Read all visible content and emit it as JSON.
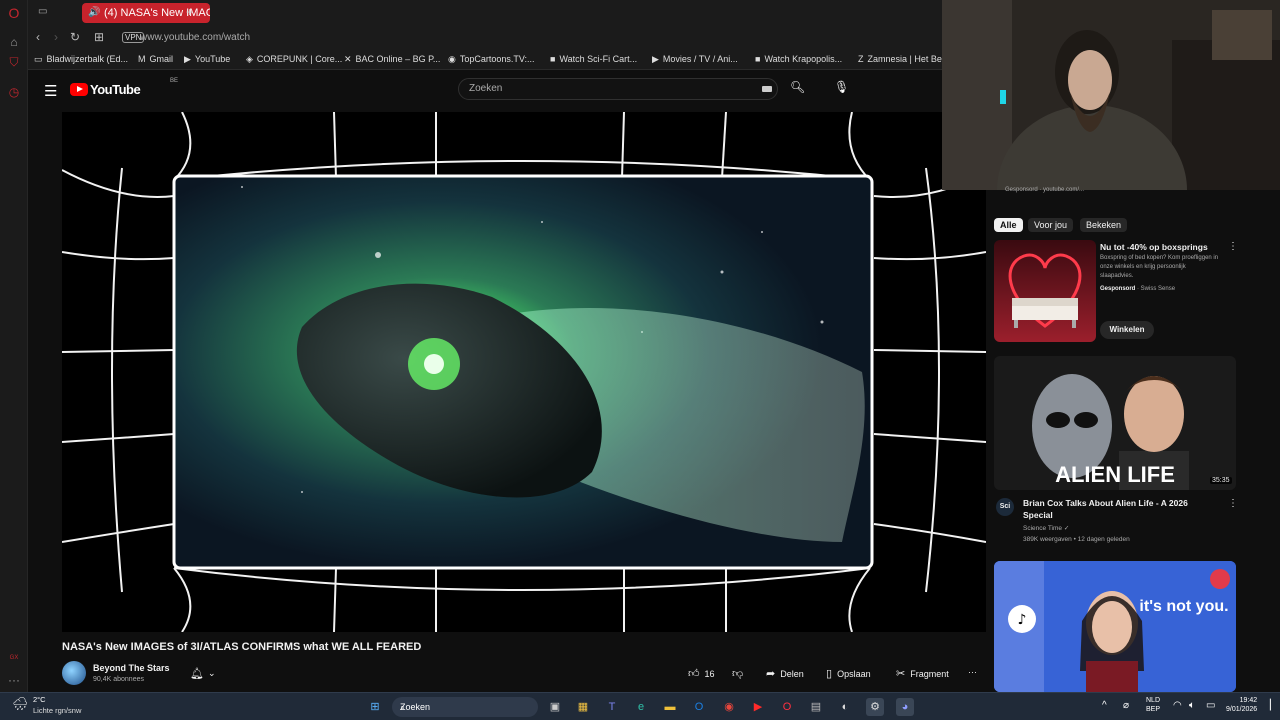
{
  "browser": {
    "active_tab_title": "(4) NASA's New IMAGE",
    "new_tab_glyph": "+",
    "url": "www.youtube.com/watch",
    "vpn_label": "VPN",
    "bookmarks": [
      {
        "icon": "▭",
        "label": "Bladwijzerbalk (Ed..."
      },
      {
        "icon": "M",
        "label": "Gmail"
      },
      {
        "icon": "▶",
        "label": "YouTube"
      },
      {
        "icon": "◈",
        "label": "COREPUNK | Core..."
      },
      {
        "icon": "✕",
        "label": "BAC Online – BG P..."
      },
      {
        "icon": "◉",
        "label": "TopCartoons.TV:..."
      },
      {
        "icon": "■",
        "label": "Watch Sci-Fi Cart..."
      },
      {
        "icon": "▶",
        "label": "Movies / TV / Ani..."
      },
      {
        "icon": "■",
        "label": "Watch Krapopolis..."
      },
      {
        "icon": "Z",
        "label": "Zamnesia | Het Be"
      }
    ]
  },
  "youtube": {
    "logo_text": "YouTube",
    "region": "BE",
    "search_placeholder": "Zoeken"
  },
  "video": {
    "title": "NASA's New IMAGES of 3I/ATLAS CONFIRMS what WE ALL FEARED",
    "channel": "Beyond The Stars",
    "subscribers": "90,4K abonnees",
    "likes": "16",
    "share_label": "Delen",
    "save_label": "Opslaan",
    "clip_label": "Fragment",
    "more_glyph": "···"
  },
  "sidebar": {
    "sponsored_top": "Gesponsord · youtube.com/...",
    "chips": [
      "Alle",
      "Voor jou",
      "Bekeken"
    ],
    "ad": {
      "title": "Nu tot -40% op boxsprings",
      "description": "Boxspring of bed kopen? Kom proefliggen in onze winkels en krijg persoonlijk slaapadvies.",
      "sponsored_label": "Gesponsord",
      "advertiser": "· Swiss Sense",
      "button": "Winkelen"
    },
    "video1": {
      "thumb_text": "ALIEN LIFE",
      "duration": "35:35",
      "avatar_text": "Sci",
      "title": "Brian Cox Talks About Alien Life - A 2026 Special",
      "channel": "Science Time ✓",
      "meta": "389K weergaven • 12 dagen geleden"
    },
    "video2": {
      "thumb_text": "it's not you."
    }
  },
  "taskbar": {
    "temperature": "2°C",
    "weather": "Lichte rgn/snw",
    "search_placeholder": "Zoeken",
    "lang_top": "NLD",
    "lang_bottom": "BEP",
    "time": "19:42",
    "date": "9/01/2026"
  }
}
